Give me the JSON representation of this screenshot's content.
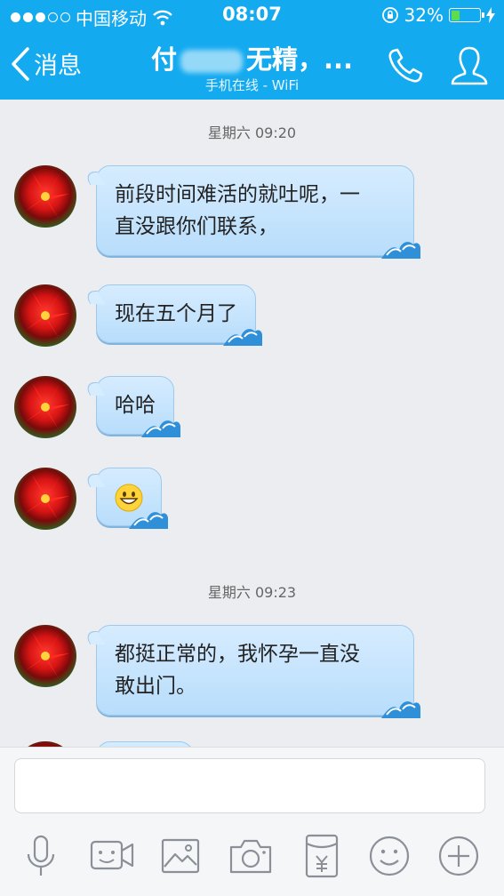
{
  "status_bar": {
    "carrier": "中国移动",
    "time": "08:07",
    "battery": "32%",
    "battery_level": 0.32
  },
  "header": {
    "back_label": "消息",
    "title_start": "付",
    "title_end": "无精，...",
    "subtitle": "手机在线 - WiFi",
    "background_color": "#14aaf0"
  },
  "chat": {
    "timestamps": [
      "星期六 09:20",
      "星期六 09:23"
    ],
    "messages": [
      {
        "text_line1": "前段时间难活的就吐呢，一",
        "text_line2": "直没跟你们联系，"
      },
      {
        "text": "现在五个月了"
      },
      {
        "text": "哈哈"
      },
      {
        "emoji": "grinning-face"
      },
      {
        "text_line1": "都挺正常的，我怀孕一直没",
        "text_line2": "敢出门。"
      }
    ]
  },
  "input": {
    "value": "",
    "placeholder": ""
  },
  "toolbar": {
    "icons": [
      "microphone-icon",
      "video-icon",
      "image-icon",
      "camera-icon",
      "red-packet-icon",
      "emoji-icon",
      "plus-icon"
    ]
  }
}
